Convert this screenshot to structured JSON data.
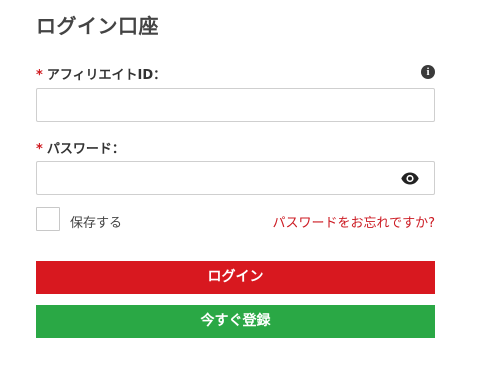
{
  "page": {
    "title": "ログイン口座"
  },
  "affiliate_id": {
    "required_mark": "*",
    "label": "アフィリエイトID：",
    "info_icon": "info-icon",
    "value": ""
  },
  "password": {
    "required_mark": "*",
    "label": "パスワード：",
    "toggle_icon": "eye-icon",
    "value": ""
  },
  "remember": {
    "label": "保存する",
    "checked": false
  },
  "forgot_password": {
    "label": "パスワードをお忘れですか?"
  },
  "buttons": {
    "login": "ログイン",
    "register": "今すぐ登録"
  },
  "colors": {
    "required": "#d0191f",
    "link": "#cc1a22",
    "login_button": "#d8181f",
    "register_button": "#2aa845"
  }
}
